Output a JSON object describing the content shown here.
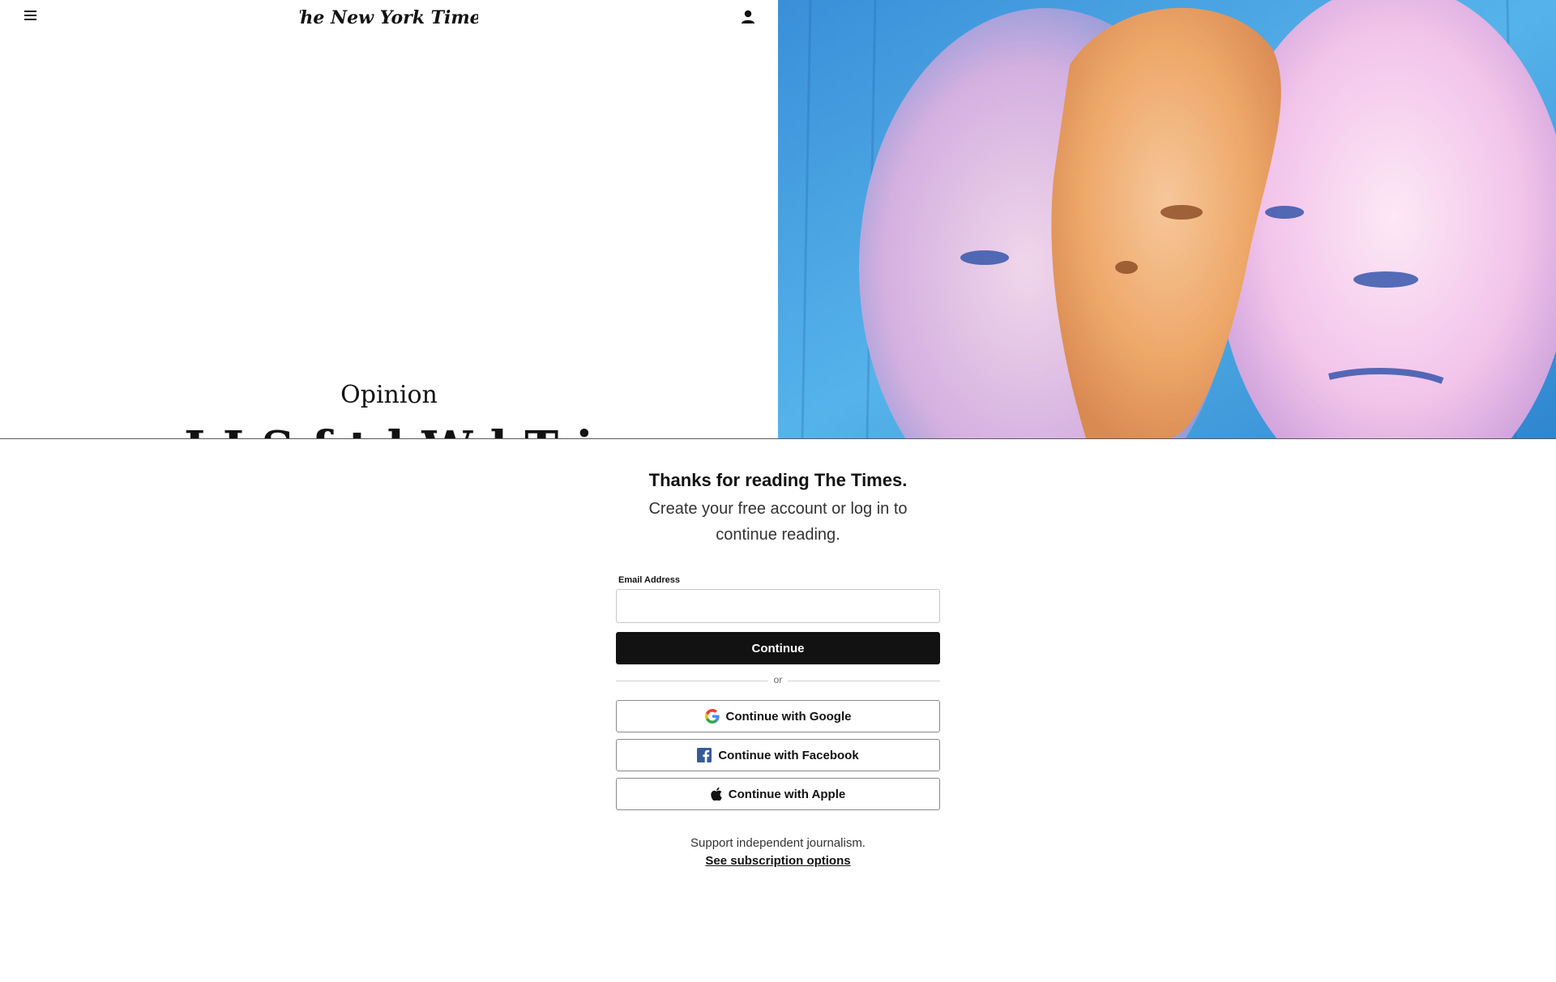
{
  "header": {
    "masthead": "The New York Times"
  },
  "article": {
    "kicker": "Opinion",
    "headline_visible_fragment": "I, L. S. ... tel W... T... i"
  },
  "gate": {
    "title": "Thanks for reading The Times.",
    "subtitle_line1": "Create your free account or log in to",
    "subtitle_line2": "continue reading.",
    "email_label": "Email Address",
    "email_value": "",
    "continue_label": "Continue",
    "divider_text": "or",
    "google_label": "Continue with Google",
    "facebook_label": "Continue with Facebook",
    "apple_label": "Continue with Apple",
    "support_text": "Support independent journalism.",
    "subscription_link": "See subscription options"
  },
  "icons": {
    "menu": "hamburger-menu-icon",
    "account": "person-icon",
    "google": "google-g-icon",
    "facebook": "facebook-f-icon",
    "apple": "apple-icon"
  },
  "colors": {
    "primary_button": "#121212",
    "facebook_blue": "#3b5998"
  }
}
